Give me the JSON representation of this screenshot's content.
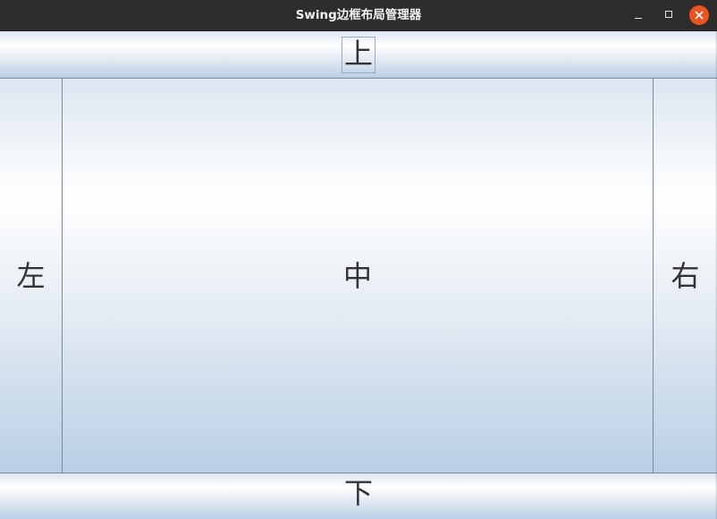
{
  "window": {
    "title": "Swing边框布局管理器",
    "controls": {
      "minimize_icon": "minimize-icon",
      "maximize_icon": "maximize-icon",
      "close_icon": "close-icon",
      "close_color": "#e95420"
    }
  },
  "layout": {
    "north": {
      "label": "上"
    },
    "west": {
      "label": "左"
    },
    "center": {
      "label": "中"
    },
    "east": {
      "label": "右"
    },
    "south": {
      "label": "下"
    }
  },
  "colors": {
    "titlebar": "#2e2d2b",
    "region_border": "#7a8a99",
    "gradient_top": "#dce6f1",
    "gradient_highlight": "#ffffff",
    "gradient_bottom": "#b9cfe5"
  }
}
